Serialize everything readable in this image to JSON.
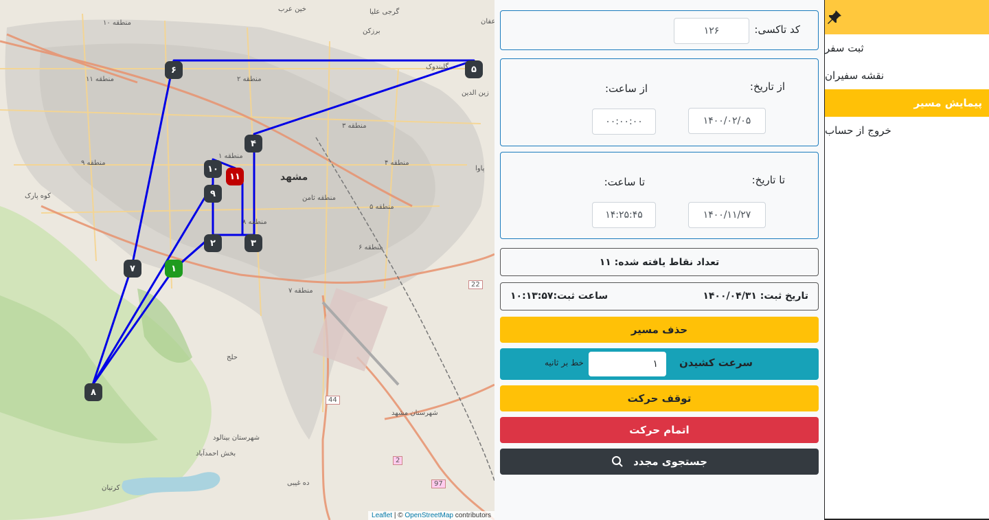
{
  "map": {
    "attribution_leaflet": "Leaflet",
    "attribution_sep": " | © ",
    "attribution_osm": "OpenStreetMap",
    "attribution_tail": " contributors",
    "city_label": "مشهد",
    "labels": [
      "منطقه ۱۰",
      "منطقه ۱۱",
      "منطقه ۹",
      "منطقه ۲",
      "منطقه ۳",
      "منطقه ۱",
      "منطقه ۴",
      "منطقه ۵",
      "منطقه ۶",
      "منطقه ۷",
      "منطقه ۸",
      "منطقه ثامن",
      "کوه پارک",
      "حلج",
      "کرتیان",
      "ده غیبی",
      "شهرستان بینالود",
      "شهرستان مشهد",
      "بخش احمدآباد",
      "خین عرب",
      "گرجی علیا",
      "برزکن",
      "زعفان",
      "زین الدین",
      "پاوا",
      "گلبندوک"
    ],
    "road_shields": [
      "22",
      "44",
      "2",
      "97"
    ],
    "markers": [
      "۱",
      "۲",
      "۳",
      "۴",
      "۵",
      "۶",
      "۷",
      "۸",
      "۹",
      "۱۰",
      "۱۱"
    ]
  },
  "form": {
    "taxi_code_label": "کد تاکسی:",
    "taxi_code_value": "۱۲۶",
    "from_date_label": "از تاریخ:",
    "from_date_value": "۱۴۰۰/۰۲/۰۵",
    "from_time_label": "از ساعت:",
    "from_time_value": "۰۰:۰۰:۰۰",
    "to_date_label": "تا تاریخ:",
    "to_date_value": "۱۴۰۰/۱۱/۲۷",
    "to_time_label": "تا ساعت:",
    "to_time_value": "۱۴:۲۵:۴۵"
  },
  "results": {
    "found_points": "تعداد نقاط یافته شده: ۱۱",
    "reg_date": "تاریخ ثبت: ۱۴۰۰/۰۴/۳۱",
    "reg_time": "ساعت ثبت:۱۰:۱۳:۵۷"
  },
  "actions": {
    "delete_route": "حذف مسیر",
    "draw_speed_label": "سرعت کشیدن",
    "draw_speed_value": "۱",
    "draw_speed_unit": "خط بر ثانیه",
    "stop": "توقف حرکت",
    "finish": "اتمام حرکت",
    "search_again": "جستجوی مجدد"
  },
  "sidebar": {
    "items": [
      {
        "label": "ثبت سفر"
      },
      {
        "label": "نقشه سفیران"
      },
      {
        "label": "پیمایش مسیر"
      },
      {
        "label": "خروج از حساب"
      }
    ]
  },
  "colors": {
    "route": "#0000e6",
    "accent": "#ffc107",
    "info": "#17a2b8",
    "danger": "#dc3545",
    "dark": "#343a40"
  }
}
